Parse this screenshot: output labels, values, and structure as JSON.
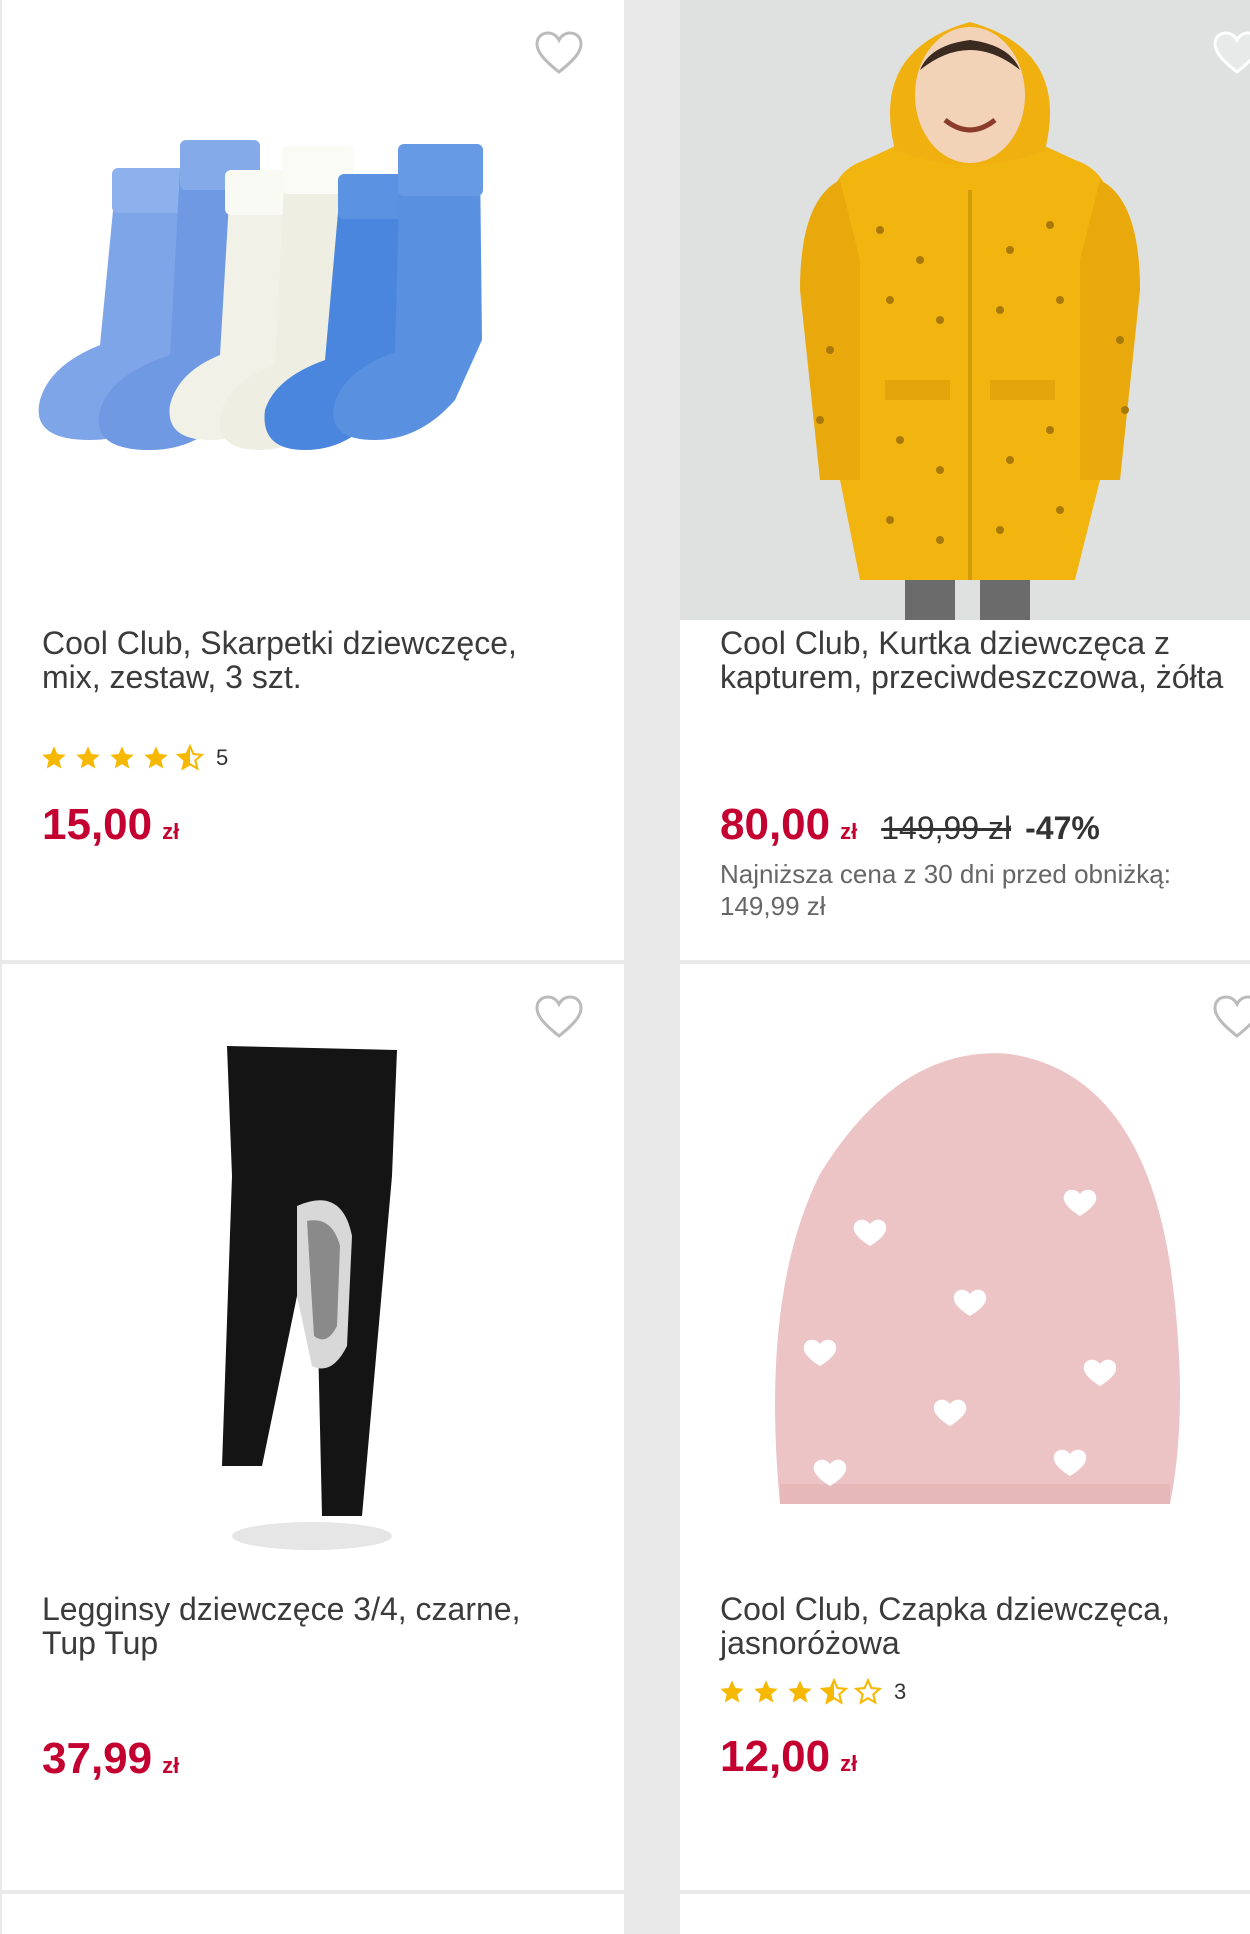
{
  "products": [
    {
      "title": "Cool Club, Skarpetki dziewczęce, mix, zestaw, 3 szt.",
      "rating_count": "5",
      "rating_value": 4.5,
      "price": "15,00",
      "currency": "zł"
    },
    {
      "title": "Cool Club, Kurtka dziewczęca z kapturem, przeciwdeszczowa, żółta",
      "price": "80,00",
      "currency": "zł",
      "old_price": "149,99 zł",
      "discount": "-47%",
      "lowest_price_note": "Najniższa cena z 30 dni przed obniżką: 149,99 zł"
    },
    {
      "title": "Legginsy dziewczęce 3/4, czarne, Tup Tup",
      "price": "37,99",
      "currency": "zł"
    },
    {
      "title": "Cool Club, Czapka dziewczęca, jasnoróżowa",
      "rating_count": "3",
      "rating_value": 3.5,
      "price": "12,00",
      "currency": "zł"
    }
  ],
  "colors": {
    "price": "#c3002f",
    "star": "#f6b800",
    "background": "#e9e9e9"
  },
  "icons": {
    "favorite": "heart-outline-icon",
    "rating": "star-icon"
  }
}
